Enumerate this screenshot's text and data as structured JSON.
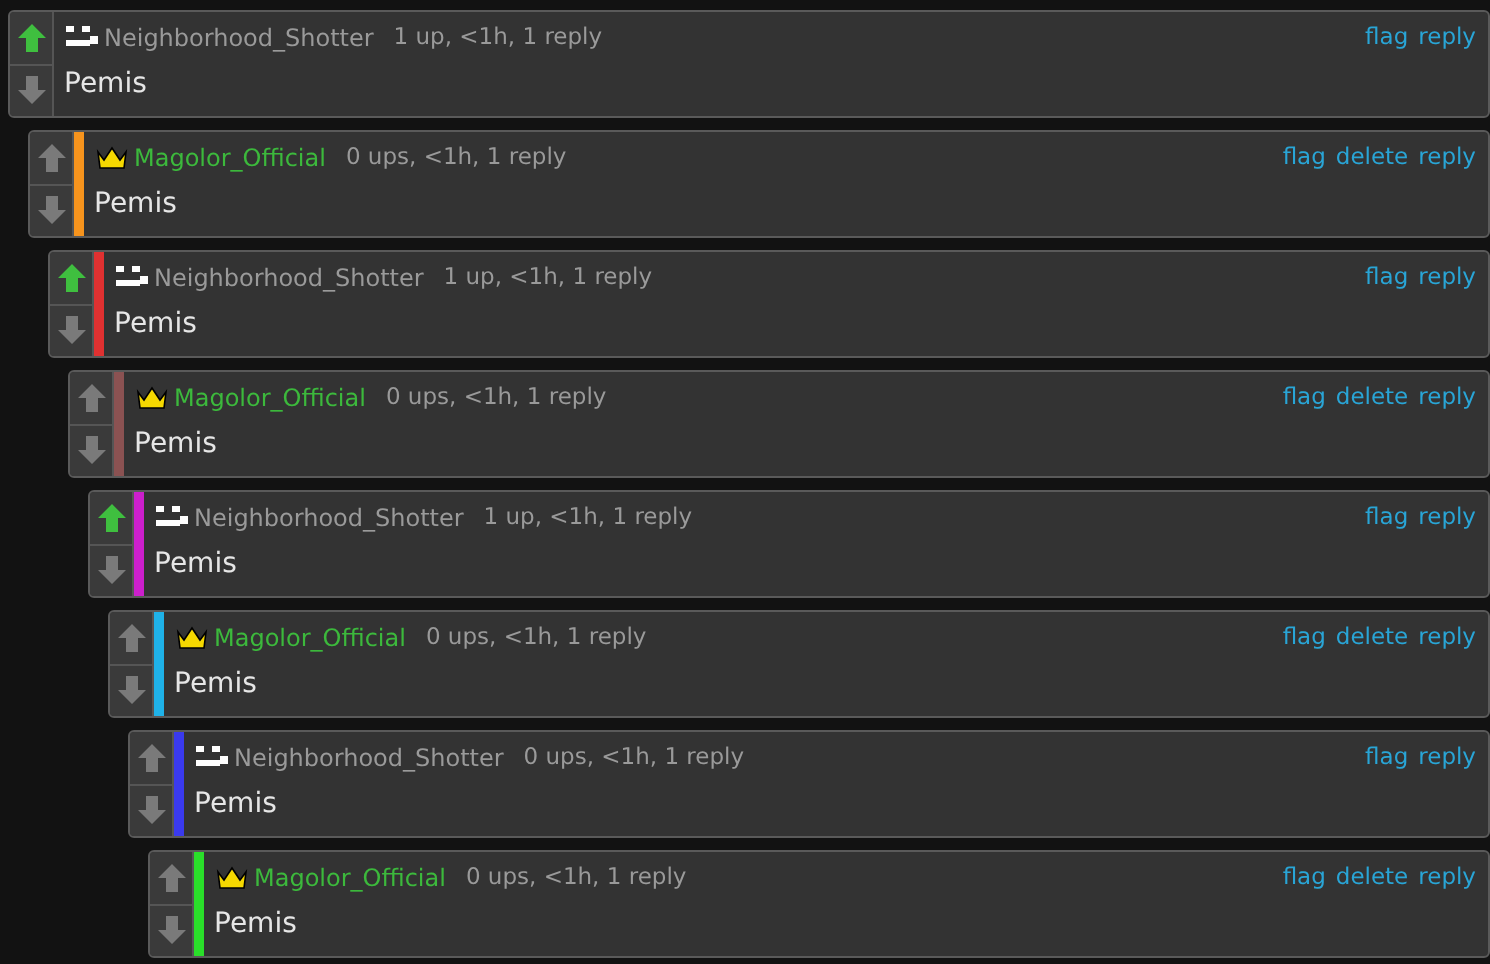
{
  "thread": [
    {
      "author": {
        "name": "Neighborhood_Shotter",
        "kind": "blocks"
      },
      "upvoted": true,
      "stats": "1 up, <1h, 1 reply",
      "actions": [
        "flag",
        "reply"
      ],
      "body": "Pemis",
      "children": [
        {
          "author": {
            "name": "Magolor_Official",
            "kind": "crown"
          },
          "color": "#f7941d",
          "upvoted": false,
          "stats": "0 ups, <1h, 1 reply",
          "actions": [
            "flag",
            "delete",
            "reply"
          ],
          "body": "Pemis",
          "children": [
            {
              "author": {
                "name": "Neighborhood_Shotter",
                "kind": "blocks"
              },
              "color": "#e03131",
              "upvoted": true,
              "stats": "1 up, <1h, 1 reply",
              "actions": [
                "flag",
                "reply"
              ],
              "body": "Pemis",
              "children": [
                {
                  "author": {
                    "name": "Magolor_Official",
                    "kind": "crown"
                  },
                  "color": "#8b5252",
                  "upvoted": false,
                  "stats": "0 ups, <1h, 1 reply",
                  "actions": [
                    "flag",
                    "delete",
                    "reply"
                  ],
                  "body": "Pemis",
                  "children": [
                    {
                      "author": {
                        "name": "Neighborhood_Shotter",
                        "kind": "blocks"
                      },
                      "color": "#cc1fcc",
                      "upvoted": true,
                      "stats": "1 up, <1h, 1 reply",
                      "actions": [
                        "flag",
                        "reply"
                      ],
                      "body": "Pemis",
                      "children": [
                        {
                          "author": {
                            "name": "Magolor_Official",
                            "kind": "crown"
                          },
                          "color": "#1fb2e8",
                          "upvoted": false,
                          "stats": "0 ups, <1h, 1 reply",
                          "actions": [
                            "flag",
                            "delete",
                            "reply"
                          ],
                          "body": "Pemis",
                          "children": [
                            {
                              "author": {
                                "name": "Neighborhood_Shotter",
                                "kind": "blocks"
                              },
                              "color": "#3a3aee",
                              "upvoted": false,
                              "stats": "0 ups, <1h, 1 reply",
                              "actions": [
                                "flag",
                                "reply"
                              ],
                              "body": "Pemis",
                              "children": [
                                {
                                  "author": {
                                    "name": "Magolor_Official",
                                    "kind": "crown"
                                  },
                                  "color": "#2ade2a",
                                  "upvoted": false,
                                  "stats": "0 ups, <1h, 1 reply",
                                  "actions": [
                                    "flag",
                                    "delete",
                                    "reply"
                                  ],
                                  "body": "Pemis"
                                }
                              ]
                            }
                          ]
                        }
                      ]
                    }
                  ]
                }
              ]
            }
          ]
        }
      ]
    }
  ]
}
